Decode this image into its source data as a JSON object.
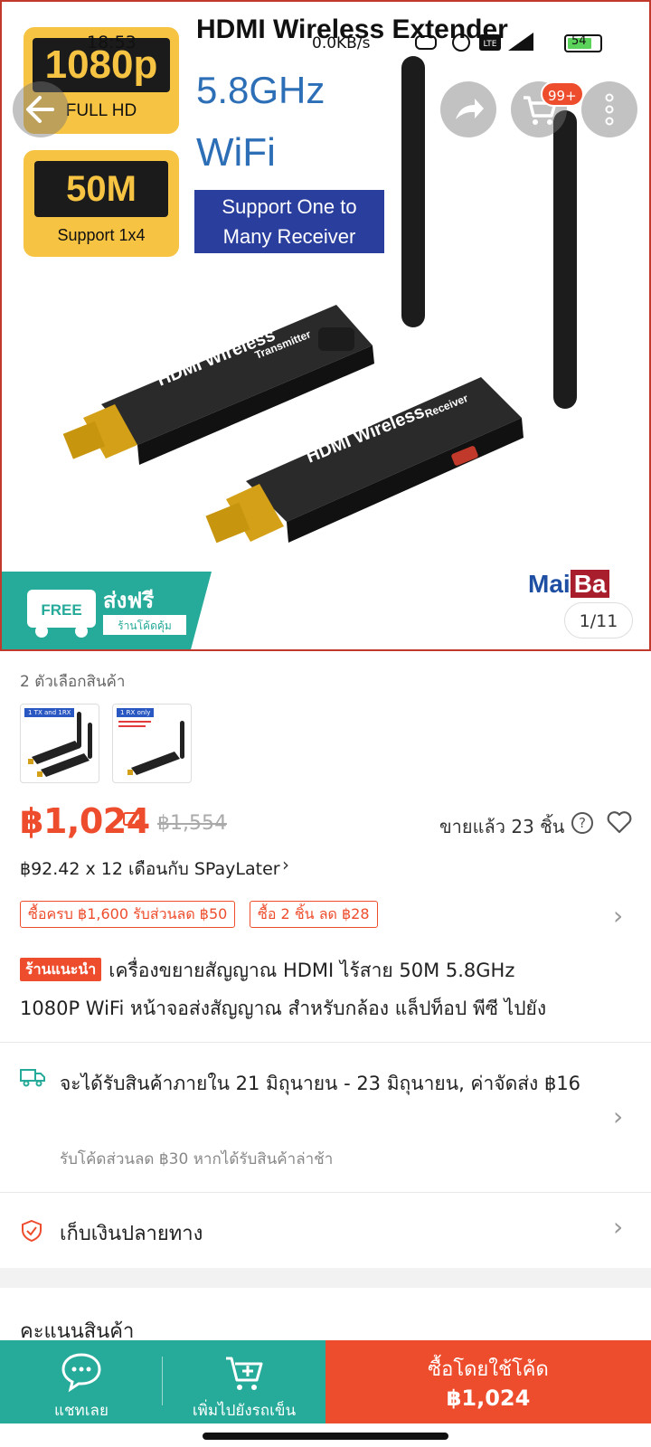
{
  "status_bar": {
    "time": "18:53",
    "net_speed": "0.0KB/s",
    "battery_level": "54",
    "network": "LTE"
  },
  "hero": {
    "title": "HDMI Wireless Extender",
    "badge_resolution": "1080p",
    "badge_resolution_sub": "FULL HD",
    "badge_distance": "50M",
    "badge_distance_sub": "Support 1x4",
    "frequency": "5.8GHz",
    "wifi": "WiFi",
    "support_line1": "Support One to",
    "support_line2": "Many Receiver",
    "device_tx_label": "HDMI Wireless",
    "device_tx_sub": "Transmitter",
    "device_rx_label": "HDMI Wireless",
    "device_rx_sub": "Receiver",
    "brand_part1": "Mai",
    "brand_part2": "Ba",
    "free_label": "FREE",
    "free_ship_text": "ส่งฟรี",
    "free_ship_sub": "ร้านโค้ดคุ้ม",
    "image_counter": "1/11",
    "cart_count": "99+"
  },
  "variants": {
    "count_label": "2 ตัวเลือกสินค้า",
    "items": [
      {
        "tag": "1 TX and 1RX"
      },
      {
        "tag": "1 RX only"
      }
    ]
  },
  "price": {
    "current": "฿1,024",
    "original": "฿1,554",
    "sold": "ขายแล้ว 23 ชิ้น",
    "installment": "฿92.42 x 12 เดือนกับ SPayLater",
    "promos": [
      "ซื้อครบ ฿1,600 รับส่วนลด ฿50",
      "ซื้อ 2 ชิ้น ลด ฿28"
    ]
  },
  "product": {
    "shop_tag": "ร้านแนะนำ",
    "title_line1": "เครื่องขยายสัญญาณ HDMI ไร้สาย 50M 5.8GHz",
    "title_line2": "1080P WiFi หน้าจอส่งสัญญาณ สำหรับกล้อง แล็ปท็อป พีซี ไปยัง"
  },
  "delivery": {
    "text": "จะได้รับสินค้าภายใน 21 มิถุนายน - 23 มิถุนายน, ค่าจัดส่ง ฿16",
    "sub": "รับโค้ดส่วนลด ฿30 หากได้รับสินค้าล่าช้า"
  },
  "cod": {
    "text": "เก็บเงินปลายทาง"
  },
  "rating": {
    "title": "คะแนนสินค้า"
  },
  "bottom_bar": {
    "chat_label": "แชทเลย",
    "add_to_cart_label": "เพิ่มไปยังรถเข็น",
    "buy_line1": "ซื้อโดยใช้โค้ด",
    "buy_line2": "฿1,024"
  },
  "colors": {
    "accent": "#ee4d2d",
    "teal": "#26aa99"
  }
}
